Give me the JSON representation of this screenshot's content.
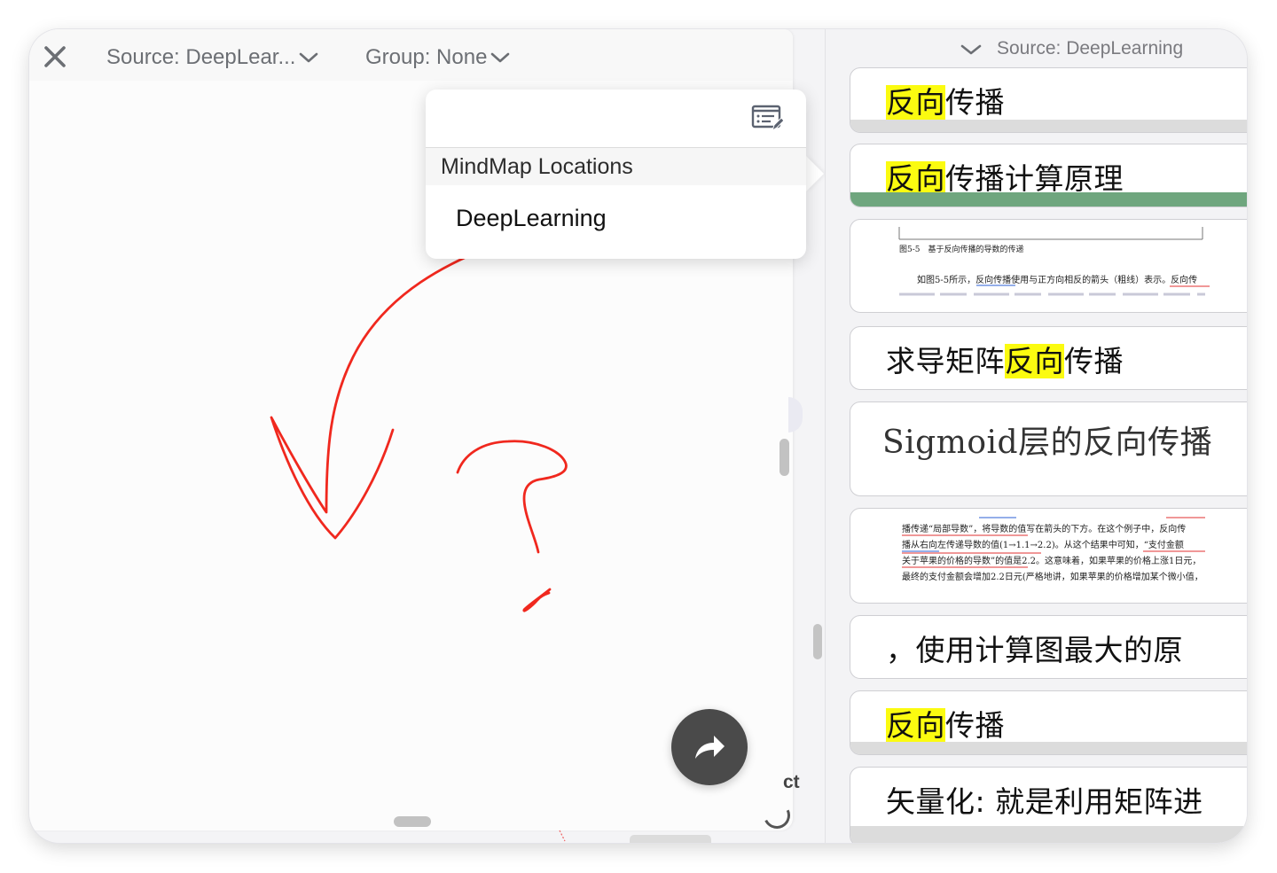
{
  "left_toolbar": {
    "source_label": "Source: DeepLear...",
    "group_label": "Group: None"
  },
  "popover": {
    "section_title": "MindMap Locations",
    "items": [
      "DeepLearning"
    ]
  },
  "behind_text": "ct",
  "right_panel": {
    "source_label": "Source: DeepLearning",
    "cards": [
      {
        "pre": "",
        "hl": "反向",
        "post": "传播"
      },
      {
        "pre": "",
        "hl": "反向",
        "post": "传播计算原理"
      },
      {
        "doc_caption": "图5-5　基于反向传播的导数的传递",
        "doc_line": "如图5-5所示，反向传播使用与正方向相反的箭头（粗线）表示。反向传"
      },
      {
        "pre": "求导矩阵",
        "hl": "反向",
        "post": "传播"
      },
      {
        "text": "Sigmoid层的反向传播"
      },
      {
        "doc_lines": [
          "播传递“局部导数”，将导数的值写在箭头的下方。在这个例子中，反向传",
          "播从右向左传递导数的值(1→1.1→2.2)。从这个结果中可知，“支付金额",
          "关于苹果的价格的导数”的值是2.2。这意味着，如果苹果的价格上涨1日元，",
          "最终的支付金额会增加2.2日元(严格地讲，如果苹果的价格增加某个微小值，"
        ]
      },
      {
        "text": "，使用计算图最大的原"
      },
      {
        "pre": "",
        "hl": "反向",
        "post": "传播"
      },
      {
        "text": "矢量化: 就是利用矩阵进"
      }
    ]
  },
  "colors": {
    "highlight": "#fbfb10",
    "ink_red": "#f0281e",
    "card_green_bar": "#6fa67e",
    "fab": "#4a4a4a"
  }
}
